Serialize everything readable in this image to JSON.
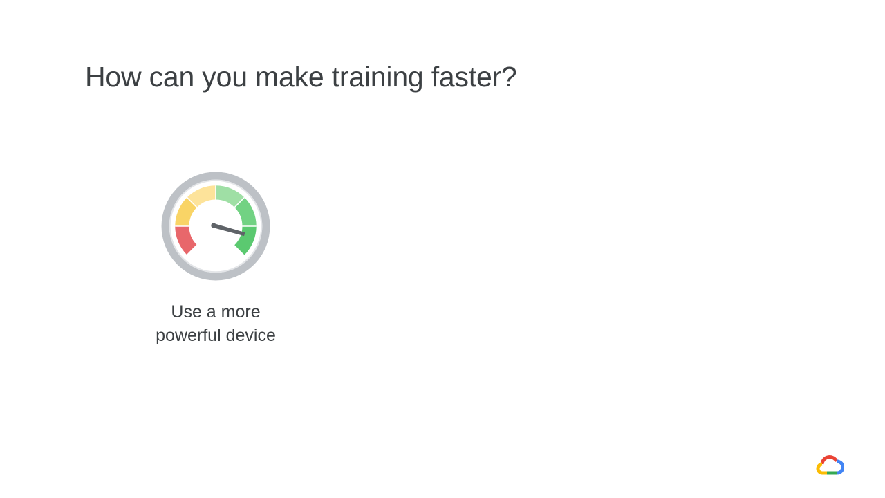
{
  "slide": {
    "title": "How can you make training faster?",
    "ideas": [
      {
        "icon": "speedometer-gauge-icon",
        "caption_line1": "Use a more",
        "caption_line2": "powerful device"
      }
    ],
    "logo": "google-cloud-logo-icon"
  },
  "colors": {
    "text": "#3c4043",
    "gauge_ring": "#bdc1c6",
    "gauge_red": "#e8676b",
    "gauge_yellow": "#f9d466",
    "gauge_light_yellow": "#fde39a",
    "gauge_light_green": "#9fdfa5",
    "gauge_green": "#5bc970",
    "gauge_needle": "#5f6368",
    "logo_red": "#ea4335",
    "logo_blue": "#4285f4",
    "logo_yellow": "#fbbc04",
    "logo_green": "#34a853"
  }
}
